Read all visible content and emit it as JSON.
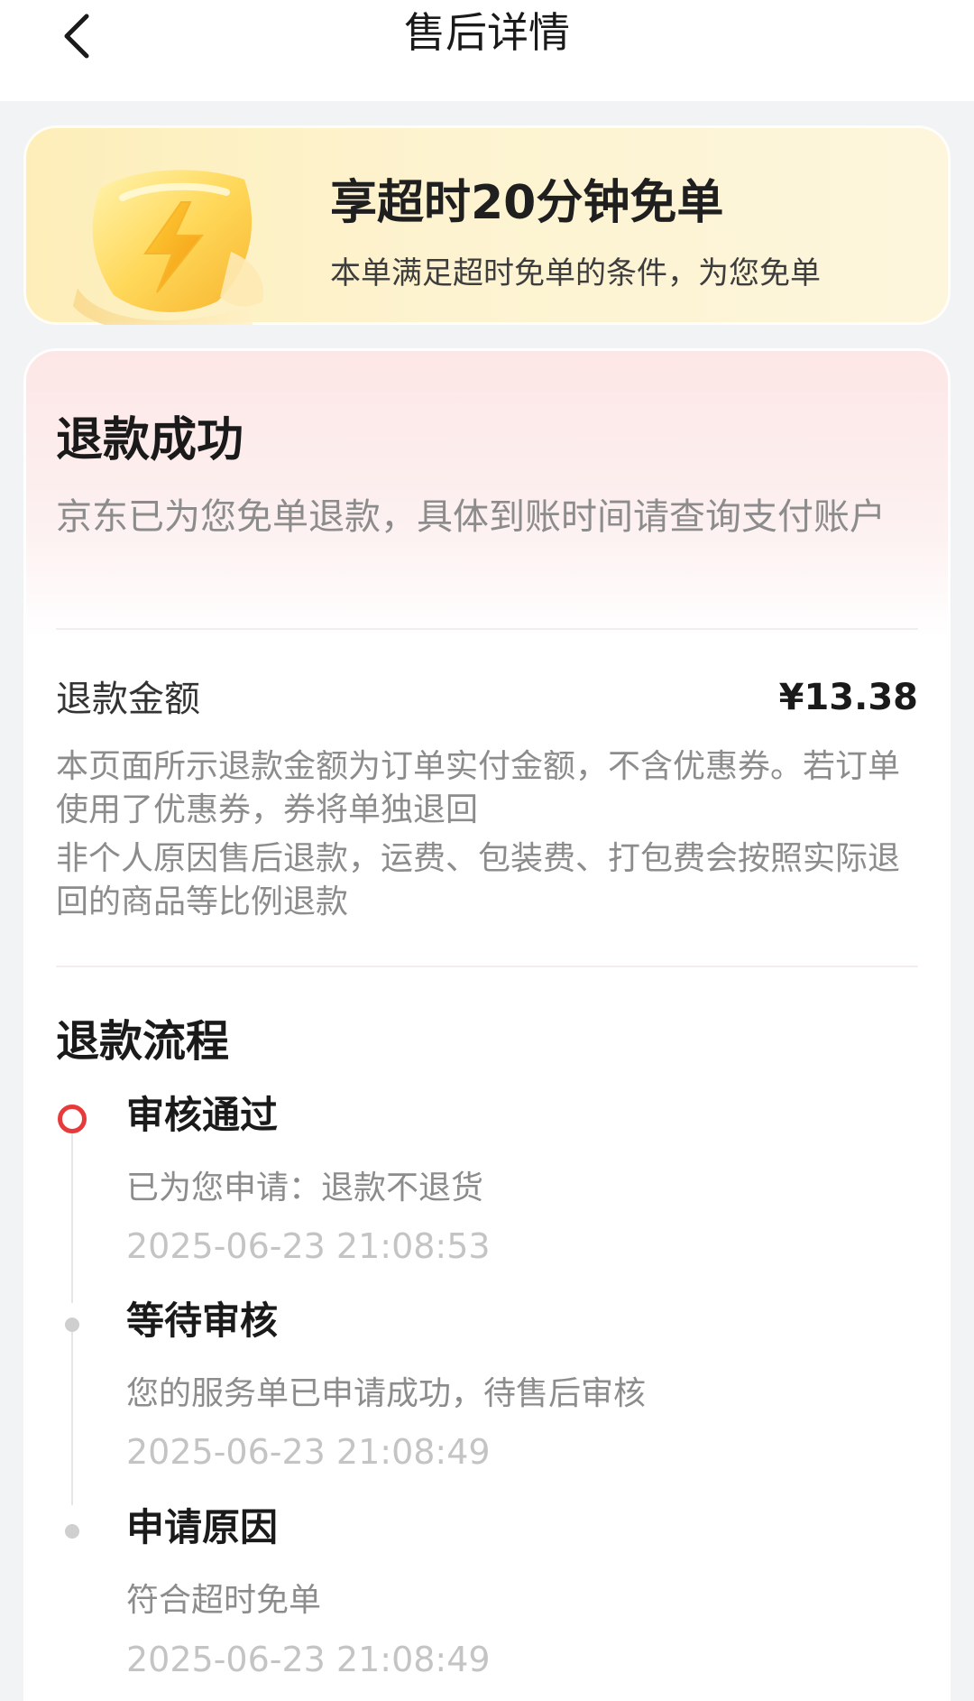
{
  "header": {
    "title": "售后详情",
    "back_icon": "chevron-left-icon"
  },
  "promo": {
    "icon": "lightning-shield-icon",
    "title": "享超时20分钟免单",
    "subtitle": "本单满足超时免单的条件，为您免单"
  },
  "status": {
    "title": "退款成功",
    "description": "京东已为您免单退款，具体到账时间请查询支付账户"
  },
  "refund": {
    "label": "退款金额",
    "amount": "¥13.38",
    "notes": [
      "本页面所示退款金额为订单实付金额，不含优惠券。若订单使用了优惠券，券将单独退回",
      "非个人原因售后退款，运费、包装费、打包费会按照实际退回的商品等比例退款"
    ]
  },
  "process": {
    "title": "退款流程",
    "steps": [
      {
        "title": "审核通过",
        "desc": "已为您申请：退款不退货",
        "time": "2025-06-23 21:08:53",
        "active": true
      },
      {
        "title": "等待审核",
        "desc": "您的服务单已申请成功，待售后审核",
        "time": "2025-06-23 21:08:49",
        "active": false
      },
      {
        "title": "申请原因",
        "desc": "符合超时免单",
        "time": "2025-06-23 21:08:49",
        "active": false
      }
    ]
  },
  "colors": {
    "accent_red": "#e83a3a",
    "promo_bg": "#fdf1c8",
    "status_bg": "#fde6e6"
  }
}
